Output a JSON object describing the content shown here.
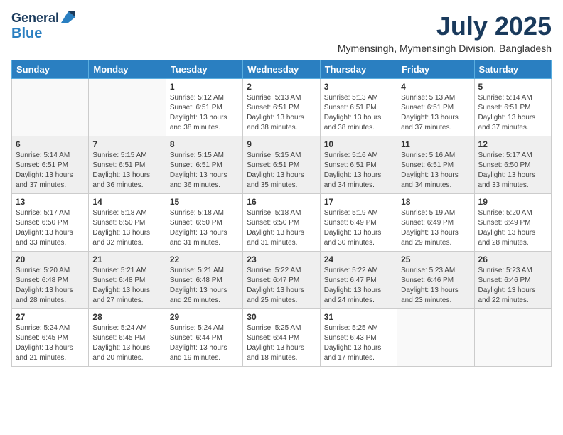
{
  "logo": {
    "line1": "General",
    "line2": "Blue"
  },
  "title": {
    "month_year": "July 2025",
    "location": "Mymensingh, Mymensingh Division, Bangladesh"
  },
  "weekdays": [
    "Sunday",
    "Monday",
    "Tuesday",
    "Wednesday",
    "Thursday",
    "Friday",
    "Saturday"
  ],
  "weeks": [
    [
      {
        "day": "",
        "sunrise": "",
        "sunset": "",
        "daylight": ""
      },
      {
        "day": "",
        "sunrise": "",
        "sunset": "",
        "daylight": ""
      },
      {
        "day": "1",
        "sunrise": "Sunrise: 5:12 AM",
        "sunset": "Sunset: 6:51 PM",
        "daylight": "Daylight: 13 hours and 38 minutes."
      },
      {
        "day": "2",
        "sunrise": "Sunrise: 5:13 AM",
        "sunset": "Sunset: 6:51 PM",
        "daylight": "Daylight: 13 hours and 38 minutes."
      },
      {
        "day": "3",
        "sunrise": "Sunrise: 5:13 AM",
        "sunset": "Sunset: 6:51 PM",
        "daylight": "Daylight: 13 hours and 38 minutes."
      },
      {
        "day": "4",
        "sunrise": "Sunrise: 5:13 AM",
        "sunset": "Sunset: 6:51 PM",
        "daylight": "Daylight: 13 hours and 37 minutes."
      },
      {
        "day": "5",
        "sunrise": "Sunrise: 5:14 AM",
        "sunset": "Sunset: 6:51 PM",
        "daylight": "Daylight: 13 hours and 37 minutes."
      }
    ],
    [
      {
        "day": "6",
        "sunrise": "Sunrise: 5:14 AM",
        "sunset": "Sunset: 6:51 PM",
        "daylight": "Daylight: 13 hours and 37 minutes."
      },
      {
        "day": "7",
        "sunrise": "Sunrise: 5:15 AM",
        "sunset": "Sunset: 6:51 PM",
        "daylight": "Daylight: 13 hours and 36 minutes."
      },
      {
        "day": "8",
        "sunrise": "Sunrise: 5:15 AM",
        "sunset": "Sunset: 6:51 PM",
        "daylight": "Daylight: 13 hours and 36 minutes."
      },
      {
        "day": "9",
        "sunrise": "Sunrise: 5:15 AM",
        "sunset": "Sunset: 6:51 PM",
        "daylight": "Daylight: 13 hours and 35 minutes."
      },
      {
        "day": "10",
        "sunrise": "Sunrise: 5:16 AM",
        "sunset": "Sunset: 6:51 PM",
        "daylight": "Daylight: 13 hours and 34 minutes."
      },
      {
        "day": "11",
        "sunrise": "Sunrise: 5:16 AM",
        "sunset": "Sunset: 6:51 PM",
        "daylight": "Daylight: 13 hours and 34 minutes."
      },
      {
        "day": "12",
        "sunrise": "Sunrise: 5:17 AM",
        "sunset": "Sunset: 6:50 PM",
        "daylight": "Daylight: 13 hours and 33 minutes."
      }
    ],
    [
      {
        "day": "13",
        "sunrise": "Sunrise: 5:17 AM",
        "sunset": "Sunset: 6:50 PM",
        "daylight": "Daylight: 13 hours and 33 minutes."
      },
      {
        "day": "14",
        "sunrise": "Sunrise: 5:18 AM",
        "sunset": "Sunset: 6:50 PM",
        "daylight": "Daylight: 13 hours and 32 minutes."
      },
      {
        "day": "15",
        "sunrise": "Sunrise: 5:18 AM",
        "sunset": "Sunset: 6:50 PM",
        "daylight": "Daylight: 13 hours and 31 minutes."
      },
      {
        "day": "16",
        "sunrise": "Sunrise: 5:18 AM",
        "sunset": "Sunset: 6:50 PM",
        "daylight": "Daylight: 13 hours and 31 minutes."
      },
      {
        "day": "17",
        "sunrise": "Sunrise: 5:19 AM",
        "sunset": "Sunset: 6:49 PM",
        "daylight": "Daylight: 13 hours and 30 minutes."
      },
      {
        "day": "18",
        "sunrise": "Sunrise: 5:19 AM",
        "sunset": "Sunset: 6:49 PM",
        "daylight": "Daylight: 13 hours and 29 minutes."
      },
      {
        "day": "19",
        "sunrise": "Sunrise: 5:20 AM",
        "sunset": "Sunset: 6:49 PM",
        "daylight": "Daylight: 13 hours and 28 minutes."
      }
    ],
    [
      {
        "day": "20",
        "sunrise": "Sunrise: 5:20 AM",
        "sunset": "Sunset: 6:48 PM",
        "daylight": "Daylight: 13 hours and 28 minutes."
      },
      {
        "day": "21",
        "sunrise": "Sunrise: 5:21 AM",
        "sunset": "Sunset: 6:48 PM",
        "daylight": "Daylight: 13 hours and 27 minutes."
      },
      {
        "day": "22",
        "sunrise": "Sunrise: 5:21 AM",
        "sunset": "Sunset: 6:48 PM",
        "daylight": "Daylight: 13 hours and 26 minutes."
      },
      {
        "day": "23",
        "sunrise": "Sunrise: 5:22 AM",
        "sunset": "Sunset: 6:47 PM",
        "daylight": "Daylight: 13 hours and 25 minutes."
      },
      {
        "day": "24",
        "sunrise": "Sunrise: 5:22 AM",
        "sunset": "Sunset: 6:47 PM",
        "daylight": "Daylight: 13 hours and 24 minutes."
      },
      {
        "day": "25",
        "sunrise": "Sunrise: 5:23 AM",
        "sunset": "Sunset: 6:46 PM",
        "daylight": "Daylight: 13 hours and 23 minutes."
      },
      {
        "day": "26",
        "sunrise": "Sunrise: 5:23 AM",
        "sunset": "Sunset: 6:46 PM",
        "daylight": "Daylight: 13 hours and 22 minutes."
      }
    ],
    [
      {
        "day": "27",
        "sunrise": "Sunrise: 5:24 AM",
        "sunset": "Sunset: 6:45 PM",
        "daylight": "Daylight: 13 hours and 21 minutes."
      },
      {
        "day": "28",
        "sunrise": "Sunrise: 5:24 AM",
        "sunset": "Sunset: 6:45 PM",
        "daylight": "Daylight: 13 hours and 20 minutes."
      },
      {
        "day": "29",
        "sunrise": "Sunrise: 5:24 AM",
        "sunset": "Sunset: 6:44 PM",
        "daylight": "Daylight: 13 hours and 19 minutes."
      },
      {
        "day": "30",
        "sunrise": "Sunrise: 5:25 AM",
        "sunset": "Sunset: 6:44 PM",
        "daylight": "Daylight: 13 hours and 18 minutes."
      },
      {
        "day": "31",
        "sunrise": "Sunrise: 5:25 AM",
        "sunset": "Sunset: 6:43 PM",
        "daylight": "Daylight: 13 hours and 17 minutes."
      },
      {
        "day": "",
        "sunrise": "",
        "sunset": "",
        "daylight": ""
      },
      {
        "day": "",
        "sunrise": "",
        "sunset": "",
        "daylight": ""
      }
    ]
  ]
}
